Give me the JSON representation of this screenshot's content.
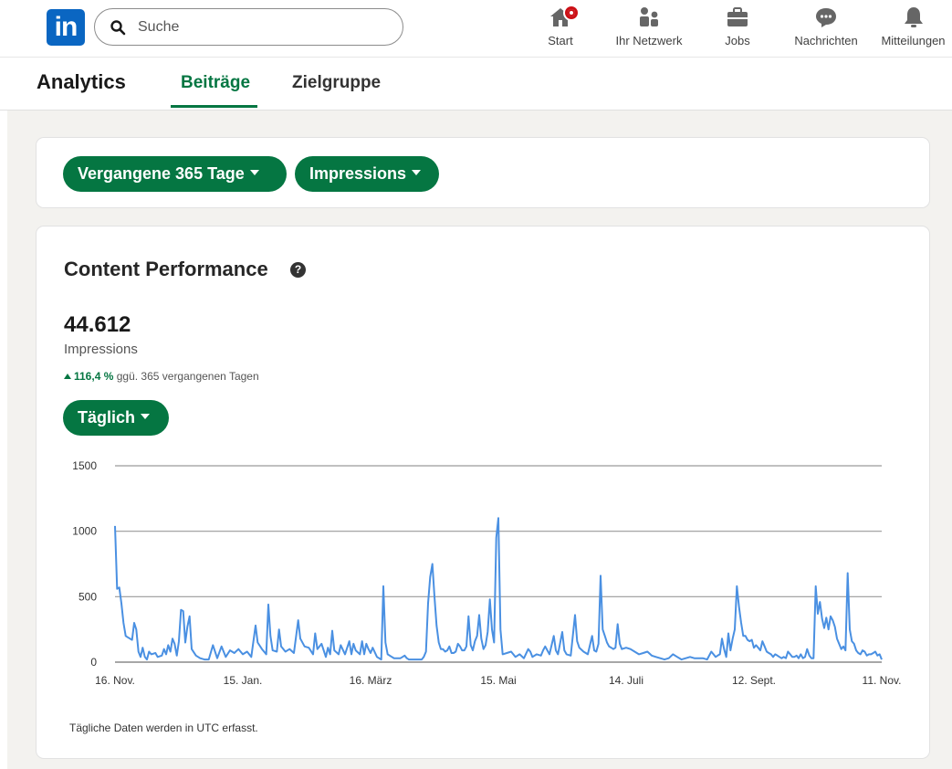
{
  "nav": {
    "logo": "in",
    "search": {
      "placeholder": "Suche",
      "value": ""
    },
    "items": [
      {
        "label": "Start",
        "icon": "home-icon"
      },
      {
        "label": "Ihr Netzwerk",
        "icon": "network-icon"
      },
      {
        "label": "Jobs",
        "icon": "briefcase-icon"
      },
      {
        "label": "Nachrichten",
        "icon": "messaging-icon"
      },
      {
        "label": "Mitteilungen",
        "icon": "bell-icon"
      }
    ],
    "accent": "#0a66c2",
    "badge_color": "#cc1016"
  },
  "subheader": {
    "title": "Analytics",
    "tabs": [
      {
        "label": "Beiträge",
        "active": true
      },
      {
        "label": "Zielgruppe",
        "active": false
      }
    ],
    "active_color": "#057642"
  },
  "filters": {
    "period": "Vergangene 365 Tage",
    "metric": "Impressions"
  },
  "performance": {
    "title": "Content Performance",
    "help_icon": "help-icon",
    "total": "44.612",
    "total_label": "Impressions",
    "change_value": "116,4 %",
    "change_text": "ggü. 365 vergangenen Tagen",
    "granularity": "Täglich",
    "footnote": "Tägliche Daten werden in UTC erfasst."
  },
  "chart_data": {
    "type": "line",
    "x_tick_labels": [
      "16. Nov.",
      "15. Jan.",
      "16. März",
      "15. Mai",
      "14. Juli",
      "12. Sept.",
      "11. Nov."
    ],
    "y_ticks": [
      0,
      500,
      1000,
      1500
    ],
    "ylim": [
      0,
      1500
    ],
    "x_range": [
      0,
      360
    ],
    "line_color": "#4a90e2",
    "grid": true,
    "series": [
      {
        "points": [
          [
            0,
            1040
          ],
          [
            1,
            560
          ],
          [
            2,
            570
          ],
          [
            3,
            450
          ],
          [
            4,
            300
          ],
          [
            5,
            200
          ],
          [
            6,
            190
          ],
          [
            8,
            170
          ],
          [
            9,
            300
          ],
          [
            10,
            250
          ],
          [
            11,
            80
          ],
          [
            12,
            40
          ],
          [
            13,
            110
          ],
          [
            14,
            40
          ],
          [
            15,
            20
          ],
          [
            16,
            80
          ],
          [
            17,
            60
          ],
          [
            19,
            70
          ],
          [
            20,
            40
          ],
          [
            22,
            50
          ],
          [
            23,
            100
          ],
          [
            24,
            60
          ],
          [
            25,
            130
          ],
          [
            26,
            80
          ],
          [
            27,
            180
          ],
          [
            28,
            140
          ],
          [
            29,
            50
          ],
          [
            30,
            160
          ],
          [
            31,
            400
          ],
          [
            32,
            390
          ],
          [
            33,
            150
          ],
          [
            34,
            270
          ],
          [
            35,
            350
          ],
          [
            36,
            100
          ],
          [
            38,
            50
          ],
          [
            40,
            30
          ],
          [
            42,
            20
          ],
          [
            44,
            20
          ],
          [
            46,
            130
          ],
          [
            48,
            30
          ],
          [
            50,
            120
          ],
          [
            52,
            40
          ],
          [
            54,
            90
          ],
          [
            56,
            70
          ],
          [
            58,
            100
          ],
          [
            60,
            60
          ],
          [
            62,
            80
          ],
          [
            64,
            40
          ],
          [
            66,
            280
          ],
          [
            67,
            150
          ],
          [
            69,
            100
          ],
          [
            71,
            60
          ],
          [
            72,
            440
          ],
          [
            73,
            200
          ],
          [
            74,
            90
          ],
          [
            76,
            80
          ],
          [
            77,
            250
          ],
          [
            78,
            120
          ],
          [
            80,
            80
          ],
          [
            82,
            100
          ],
          [
            84,
            70
          ],
          [
            86,
            320
          ],
          [
            87,
            180
          ],
          [
            89,
            120
          ],
          [
            91,
            110
          ],
          [
            93,
            60
          ],
          [
            94,
            220
          ],
          [
            95,
            100
          ],
          [
            97,
            140
          ],
          [
            99,
            40
          ],
          [
            100,
            110
          ],
          [
            101,
            60
          ],
          [
            102,
            240
          ],
          [
            103,
            90
          ],
          [
            105,
            60
          ],
          [
            106,
            130
          ],
          [
            108,
            60
          ],
          [
            110,
            160
          ],
          [
            111,
            60
          ],
          [
            112,
            140
          ],
          [
            113,
            90
          ],
          [
            115,
            60
          ],
          [
            116,
            160
          ],
          [
            117,
            60
          ],
          [
            118,
            140
          ],
          [
            119,
            100
          ],
          [
            120,
            70
          ],
          [
            121,
            110
          ],
          [
            123,
            40
          ],
          [
            125,
            20
          ],
          [
            126,
            580
          ],
          [
            127,
            150
          ],
          [
            128,
            60
          ],
          [
            130,
            40
          ],
          [
            131,
            30
          ],
          [
            133,
            30
          ],
          [
            134,
            30
          ],
          [
            135,
            40
          ],
          [
            136,
            50
          ],
          [
            137,
            30
          ],
          [
            138,
            20
          ],
          [
            139,
            20
          ],
          [
            140,
            20
          ],
          [
            141,
            20
          ],
          [
            142,
            20
          ],
          [
            143,
            20
          ],
          [
            144,
            20
          ],
          [
            145,
            40
          ],
          [
            146,
            80
          ],
          [
            147,
            450
          ],
          [
            148,
            650
          ],
          [
            149,
            750
          ],
          [
            150,
            500
          ],
          [
            151,
            280
          ],
          [
            152,
            150
          ],
          [
            153,
            100
          ],
          [
            154,
            100
          ],
          [
            155,
            80
          ],
          [
            156,
            90
          ],
          [
            157,
            120
          ],
          [
            158,
            70
          ],
          [
            159,
            70
          ],
          [
            160,
            80
          ],
          [
            161,
            140
          ],
          [
            162,
            120
          ],
          [
            163,
            90
          ],
          [
            164,
            90
          ],
          [
            165,
            120
          ],
          [
            166,
            350
          ],
          [
            167,
            130
          ],
          [
            168,
            90
          ],
          [
            169,
            160
          ],
          [
            170,
            200
          ],
          [
            171,
            360
          ],
          [
            172,
            180
          ],
          [
            173,
            100
          ],
          [
            174,
            130
          ],
          [
            175,
            230
          ],
          [
            176,
            480
          ],
          [
            177,
            250
          ],
          [
            178,
            150
          ],
          [
            179,
            950
          ],
          [
            180,
            1100
          ],
          [
            181,
            250
          ],
          [
            182,
            60
          ],
          [
            184,
            70
          ],
          [
            186,
            80
          ],
          [
            188,
            40
          ],
          [
            190,
            60
          ],
          [
            192,
            30
          ],
          [
            194,
            100
          ],
          [
            195,
            80
          ],
          [
            196,
            40
          ],
          [
            198,
            60
          ],
          [
            200,
            50
          ],
          [
            201,
            90
          ],
          [
            202,
            120
          ],
          [
            204,
            60
          ],
          [
            206,
            200
          ],
          [
            207,
            90
          ],
          [
            208,
            60
          ],
          [
            210,
            230
          ],
          [
            211,
            90
          ],
          [
            212,
            60
          ],
          [
            214,
            50
          ],
          [
            216,
            360
          ],
          [
            217,
            160
          ],
          [
            218,
            110
          ],
          [
            220,
            80
          ],
          [
            222,
            60
          ],
          [
            224,
            200
          ],
          [
            225,
            90
          ],
          [
            226,
            80
          ],
          [
            227,
            140
          ],
          [
            228,
            660
          ],
          [
            229,
            250
          ],
          [
            230,
            200
          ],
          [
            231,
            150
          ],
          [
            232,
            120
          ],
          [
            233,
            110
          ],
          [
            234,
            100
          ],
          [
            235,
            110
          ],
          [
            236,
            290
          ],
          [
            237,
            140
          ],
          [
            238,
            100
          ],
          [
            240,
            110
          ],
          [
            242,
            100
          ],
          [
            244,
            80
          ],
          [
            246,
            60
          ],
          [
            248,
            70
          ],
          [
            250,
            80
          ],
          [
            252,
            50
          ],
          [
            254,
            40
          ],
          [
            256,
            30
          ],
          [
            258,
            20
          ],
          [
            260,
            30
          ],
          [
            262,
            60
          ],
          [
            264,
            40
          ],
          [
            266,
            20
          ],
          [
            268,
            30
          ],
          [
            270,
            40
          ],
          [
            272,
            30
          ],
          [
            274,
            30
          ],
          [
            276,
            30
          ],
          [
            278,
            20
          ],
          [
            280,
            80
          ],
          [
            281,
            60
          ],
          [
            282,
            40
          ],
          [
            283,
            50
          ],
          [
            284,
            60
          ],
          [
            285,
            180
          ],
          [
            286,
            100
          ],
          [
            287,
            40
          ],
          [
            288,
            220
          ],
          [
            289,
            90
          ],
          [
            290,
            180
          ],
          [
            291,
            250
          ],
          [
            292,
            580
          ],
          [
            293,
            420
          ],
          [
            294,
            300
          ],
          [
            295,
            200
          ],
          [
            296,
            200
          ],
          [
            297,
            170
          ],
          [
            298,
            160
          ],
          [
            299,
            170
          ],
          [
            300,
            110
          ],
          [
            301,
            130
          ],
          [
            302,
            110
          ],
          [
            303,
            90
          ],
          [
            304,
            160
          ],
          [
            305,
            120
          ],
          [
            306,
            80
          ],
          [
            307,
            70
          ],
          [
            308,
            60
          ],
          [
            309,
            40
          ],
          [
            310,
            60
          ],
          [
            311,
            50
          ],
          [
            312,
            40
          ],
          [
            313,
            30
          ],
          [
            314,
            40
          ],
          [
            315,
            30
          ],
          [
            316,
            80
          ],
          [
            317,
            60
          ],
          [
            318,
            40
          ],
          [
            319,
            40
          ],
          [
            320,
            50
          ],
          [
            321,
            30
          ],
          [
            322,
            60
          ],
          [
            323,
            30
          ],
          [
            324,
            40
          ],
          [
            325,
            100
          ],
          [
            326,
            50
          ],
          [
            327,
            30
          ],
          [
            328,
            30
          ],
          [
            329,
            580
          ],
          [
            330,
            370
          ],
          [
            331,
            460
          ],
          [
            332,
            330
          ],
          [
            333,
            260
          ],
          [
            334,
            340
          ],
          [
            335,
            250
          ],
          [
            336,
            350
          ],
          [
            337,
            320
          ],
          [
            338,
            270
          ],
          [
            339,
            180
          ],
          [
            340,
            140
          ],
          [
            341,
            100
          ],
          [
            342,
            120
          ],
          [
            343,
            90
          ],
          [
            344,
            680
          ],
          [
            345,
            250
          ],
          [
            346,
            160
          ],
          [
            347,
            140
          ],
          [
            348,
            90
          ],
          [
            349,
            70
          ],
          [
            350,
            60
          ],
          [
            351,
            90
          ],
          [
            352,
            80
          ],
          [
            353,
            50
          ],
          [
            354,
            60
          ],
          [
            355,
            60
          ],
          [
            356,
            70
          ],
          [
            357,
            80
          ],
          [
            358,
            50
          ],
          [
            359,
            60
          ],
          [
            360,
            20
          ]
        ]
      }
    ]
  }
}
